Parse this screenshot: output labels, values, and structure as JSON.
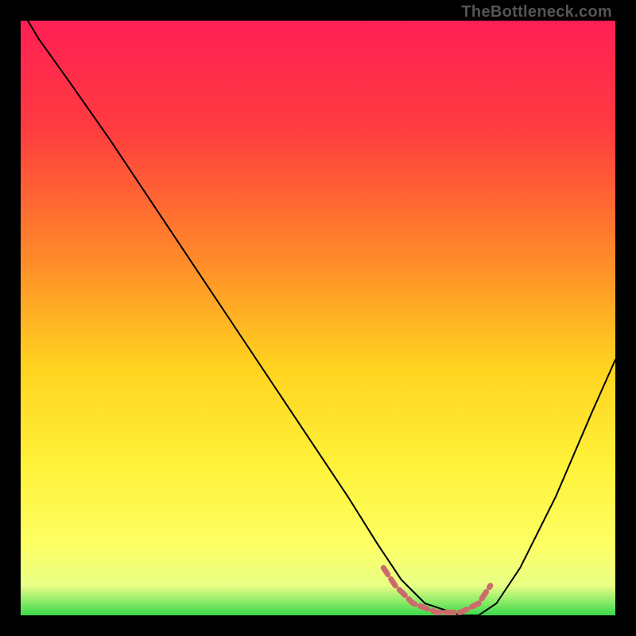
{
  "watermark": "TheBottleneck.com",
  "chart_data": {
    "type": "line",
    "title": "",
    "xlabel": "",
    "ylabel": "",
    "xlim": [
      0,
      100
    ],
    "ylim": [
      0,
      100
    ],
    "gradient_stops": [
      {
        "offset": 0,
        "color": "#ff1f55"
      },
      {
        "offset": 18,
        "color": "#ff3b3f"
      },
      {
        "offset": 40,
        "color": "#ff8a29"
      },
      {
        "offset": 58,
        "color": "#ffd21f"
      },
      {
        "offset": 75,
        "color": "#fff23a"
      },
      {
        "offset": 88,
        "color": "#fdff63"
      },
      {
        "offset": 95,
        "color": "#e9ff86"
      },
      {
        "offset": 100,
        "color": "#3bd94c"
      }
    ],
    "series": [
      {
        "name": "bottleneck-curve",
        "color": "#000000",
        "stroke_width": 2,
        "x": [
          0,
          3,
          8,
          15,
          25,
          35,
          45,
          55,
          60,
          64,
          68,
          74,
          77,
          80,
          84,
          90,
          96,
          100
        ],
        "values": [
          102,
          97,
          90,
          80,
          65,
          50,
          35,
          20,
          12,
          6,
          2,
          0,
          0,
          2,
          8,
          20,
          34,
          43
        ]
      },
      {
        "name": "optimal-band",
        "color": "#cc6b6b",
        "stroke_width": 7,
        "stroke_dasharray": "10,7",
        "x": [
          61,
          63,
          66,
          70,
          74,
          77,
          79
        ],
        "values": [
          8,
          5,
          2,
          0.5,
          0.5,
          2,
          5
        ]
      }
    ]
  }
}
